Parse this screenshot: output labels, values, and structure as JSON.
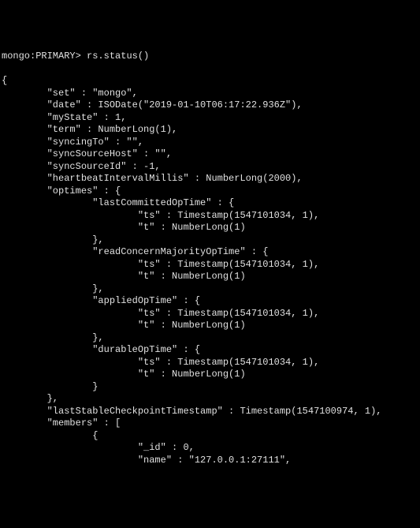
{
  "prompt": "mongo:PRIMARY>",
  "command": "rs.status()",
  "lines": [
    "{",
    "        \"set\" : \"mongo\",",
    "        \"date\" : ISODate(\"2019-01-10T06:17:22.936Z\"),",
    "        \"myState\" : 1,",
    "        \"term\" : NumberLong(1),",
    "        \"syncingTo\" : \"\",",
    "        \"syncSourceHost\" : \"\",",
    "        \"syncSourceId\" : -1,",
    "        \"heartbeatIntervalMillis\" : NumberLong(2000),",
    "        \"optimes\" : {",
    "                \"lastCommittedOpTime\" : {",
    "                        \"ts\" : Timestamp(1547101034, 1),",
    "                        \"t\" : NumberLong(1)",
    "                },",
    "                \"readConcernMajorityOpTime\" : {",
    "                        \"ts\" : Timestamp(1547101034, 1),",
    "                        \"t\" : NumberLong(1)",
    "                },",
    "                \"appliedOpTime\" : {",
    "                        \"ts\" : Timestamp(1547101034, 1),",
    "                        \"t\" : NumberLong(1)",
    "                },",
    "                \"durableOpTime\" : {",
    "                        \"ts\" : Timestamp(1547101034, 1),",
    "                        \"t\" : NumberLong(1)",
    "                }",
    "        },",
    "        \"lastStableCheckpointTimestamp\" : Timestamp(1547100974, 1),",
    "        \"members\" : [",
    "                {",
    "                        \"_id\" : 0,",
    "                        \"name\" : \"127.0.0.1:27111\","
  ]
}
